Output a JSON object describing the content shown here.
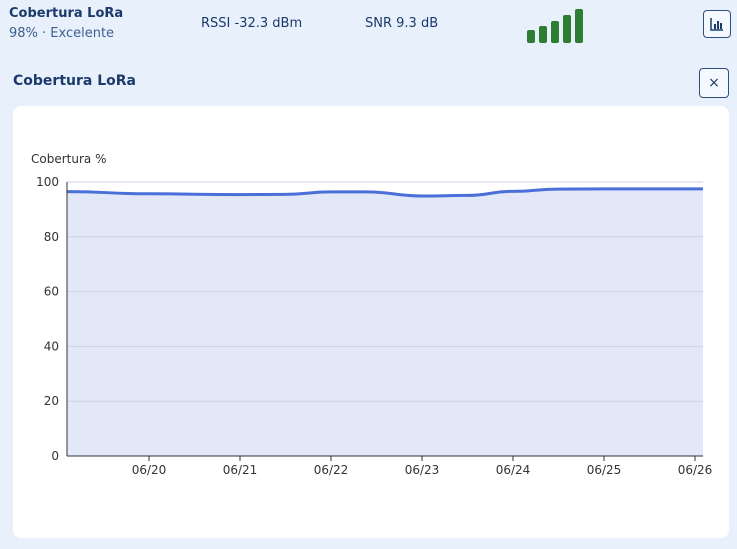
{
  "status": {
    "title": "Cobertura LoRa",
    "subtitle": "98% · Excelente",
    "rssi": "RSSI -32.3 dBm",
    "snr": "SNR 9.3 dB",
    "signal_bars": 5,
    "signal_color": "#2e7d32",
    "chart_button_icon": "bar-chart-icon"
  },
  "panel": {
    "title": "Cobertura LoRa",
    "close_label": "×"
  },
  "chart_data": {
    "type": "area",
    "ylabel": "Cobertura %",
    "ylim": [
      0,
      100
    ],
    "yticks": [
      0,
      20,
      40,
      60,
      80,
      100
    ],
    "xticks": [
      "06/20",
      "06/21",
      "06/22",
      "06/23",
      "06/24",
      "06/25",
      "06/26"
    ],
    "x": [
      "06/19 02:00",
      "06/20",
      "06/21",
      "06/21 12:00",
      "06/22",
      "06/22 09:00",
      "06/23",
      "06/23 12:00",
      "06/24",
      "06/24 12:00",
      "06/25",
      "06/25 12:00",
      "06/26"
    ],
    "values": [
      96.5,
      95.7,
      95.4,
      95.5,
      96.4,
      96.4,
      94.9,
      95.1,
      96.6,
      97.4,
      97.5,
      97.5,
      97.5
    ],
    "line_color": "#4a6fd8",
    "fill_color": "#e3e8f8",
    "grid": true
  }
}
